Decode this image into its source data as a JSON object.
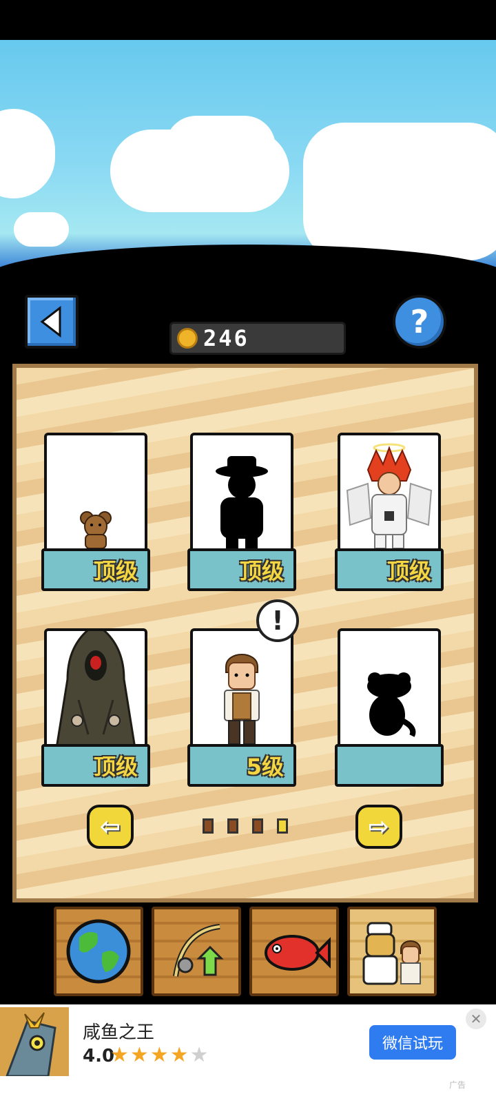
{
  "header": {
    "back_icon": "back-arrow-icon",
    "help_label": "?",
    "coins": "246"
  },
  "cards": [
    {
      "level": "顶级",
      "art": "bear-icon"
    },
    {
      "level": "顶级",
      "art": "silhouette-hat-icon"
    },
    {
      "level": "顶级",
      "art": "angel-hero-icon"
    },
    {
      "level": "顶级",
      "art": "hooded-figure-icon"
    },
    {
      "level": "5级",
      "art": "boy-character-icon",
      "badge": "!"
    },
    {
      "level": "",
      "art": "silhouette-dog-icon"
    }
  ],
  "pager": {
    "prev_label": "⇦",
    "next_label": "⇨",
    "pages": 4,
    "active_page": 4
  },
  "toolbar": [
    {
      "name": "world",
      "icon": "globe-icon"
    },
    {
      "name": "rod",
      "icon": "fishing-rod-upgrade-icon"
    },
    {
      "name": "fish",
      "icon": "fish-icon"
    },
    {
      "name": "characters",
      "icon": "characters-icon",
      "active": true
    }
  ],
  "ad": {
    "title": "咸鱼之王",
    "rating": "4.0",
    "stars_filled": 4,
    "stars_total": 5,
    "button_label": "微信试玩",
    "close_label": "✕",
    "ad_label": "广告"
  }
}
